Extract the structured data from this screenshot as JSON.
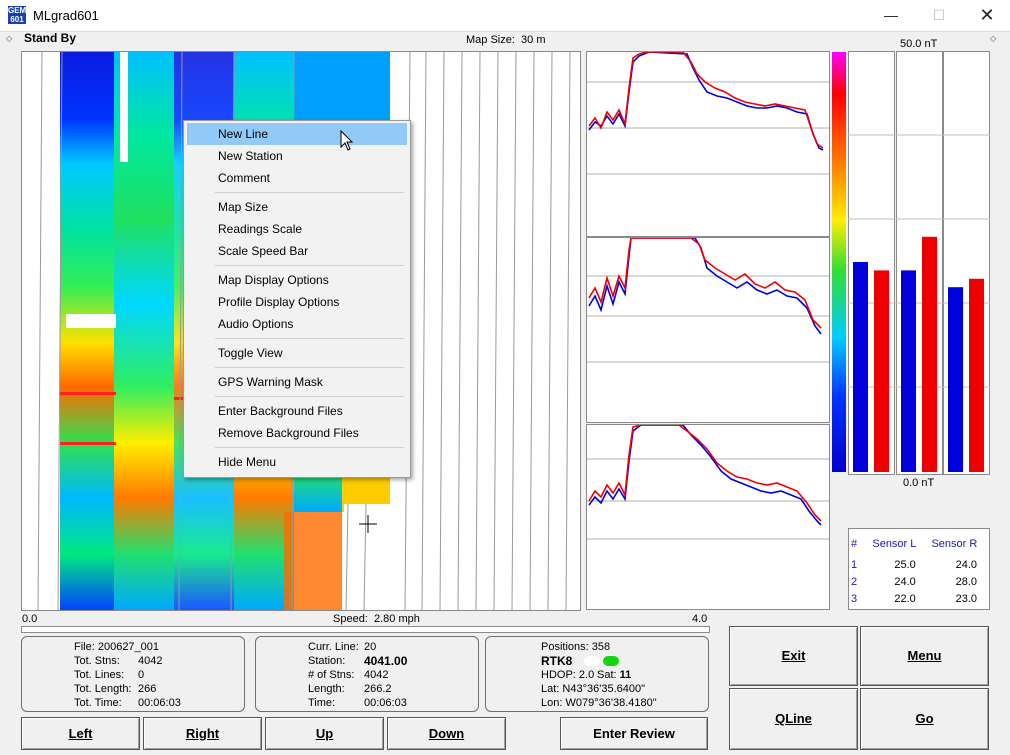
{
  "window": {
    "title": "MLgrad601",
    "app_icon_text": "GEM 601"
  },
  "status": {
    "mode": "Stand By",
    "map_size_label": "Map Size:",
    "map_size_value": "30 m"
  },
  "context_menu": {
    "items": [
      {
        "label": "New Line",
        "highlighted": true
      },
      {
        "label": "New Station"
      },
      {
        "label": "Comment"
      },
      {
        "label": "Map Size"
      },
      {
        "label": "Readings Scale"
      },
      {
        "label": "Scale Speed Bar"
      },
      {
        "label": "Map Display Options"
      },
      {
        "label": "Profile Display Options"
      },
      {
        "label": "Audio Options"
      },
      {
        "label": "Toggle View"
      },
      {
        "label": "GPS Warning Mask"
      },
      {
        "label": "Enter Background Files"
      },
      {
        "label": "Remove Background Files"
      },
      {
        "label": "Hide Menu"
      }
    ]
  },
  "scale": {
    "top_label": "50.0 nT",
    "bottom_label": "0.0 nT"
  },
  "bars": {
    "max_nT": 50,
    "groups": [
      {
        "blue": 25.0,
        "red": 24.0
      },
      {
        "blue": 24.0,
        "red": 28.0
      },
      {
        "blue": 22.0,
        "red": 23.0
      }
    ]
  },
  "sensor_table": {
    "headers": [
      "#",
      "Sensor L",
      "Sensor R"
    ],
    "rows": [
      [
        "1",
        "25.0",
        "24.0"
      ],
      [
        "2",
        "24.0",
        "28.0"
      ],
      [
        "3",
        "22.0",
        "23.0"
      ]
    ]
  },
  "speed": {
    "min": "0.0",
    "label": "Speed:",
    "value": "2.80 mph",
    "max": "4.0"
  },
  "file_info": {
    "file_label": "File:",
    "file_value": "200627_001",
    "stns_label": "Tot. Stns:",
    "stns_value": "4042",
    "lines_label": "Tot. Lines:",
    "lines_value": "0",
    "length_label": "Tot. Length:",
    "length_value": "266",
    "time_label": "Tot. Time:",
    "time_value": "00:06:03"
  },
  "line_info": {
    "line_label": "Curr. Line:",
    "line_value": "20",
    "station_label": "Station:",
    "station_value": "4041.00",
    "nstns_label": "# of Stns:",
    "nstns_value": "4042",
    "length_label": "Length:",
    "length_value": "266.2",
    "time_label": "Time:",
    "time_value": "00:06:03"
  },
  "gps_info": {
    "positions_label": "Positions:",
    "positions_value": "358",
    "rtk": "RTK8",
    "hdop_label": "HDOP:",
    "hdop_value": "2.0",
    "sat_label": "Sat:",
    "sat_value": "11",
    "lat_label": "Lat:",
    "lat_value": "N43°36'35.6400\"",
    "lon_label": "Lon:",
    "lon_value": "W079°36'38.4180\""
  },
  "buttons": {
    "left": "Left",
    "right": "Right",
    "up": "Up",
    "down": "Down",
    "enter_review": "Enter Review",
    "exit": "Exit",
    "menu": "Menu",
    "qline": "QLine",
    "go": "Go"
  },
  "colors": {
    "blue_series": "#0000dd",
    "red_series": "#ee0000",
    "highlight": "#91c9f7"
  }
}
